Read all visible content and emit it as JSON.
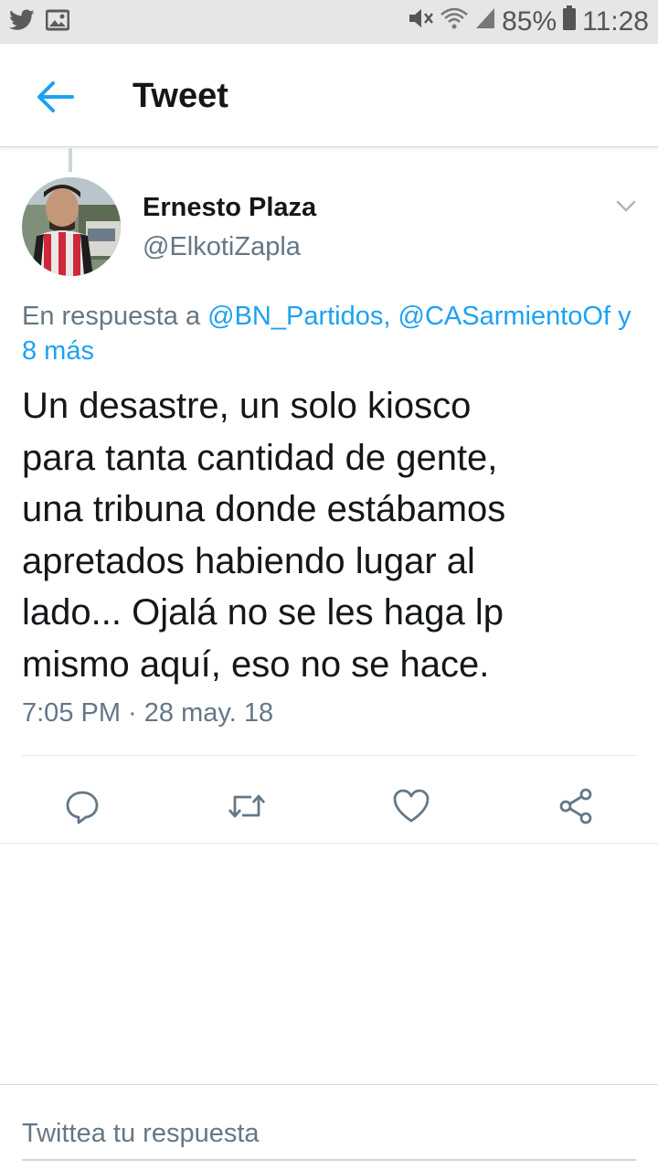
{
  "status_bar": {
    "battery": "85%",
    "time": "11:28",
    "icons": [
      "twitter-icon",
      "image-icon",
      "mute-icon",
      "wifi-icon",
      "signal-icon",
      "battery-icon"
    ]
  },
  "appbar": {
    "title": "Tweet"
  },
  "tweet": {
    "author_name": "Ernesto Plaza",
    "author_handle": "@ElkotiZapla",
    "reply_prefix": "En respuesta a ",
    "reply_mention_1": "@BN_Partidos,",
    "reply_mention_2": "@CASarmientoOf",
    "reply_suffix": " y",
    "reply_more": "8 más",
    "text_lines": [
      "Un desastre, un solo kiosco",
      "para tanta cantidad de gente,",
      "una tribuna donde estábamos",
      "apretados habiendo lugar al",
      "lado... Ojalá no se les haga lp",
      "mismo aquí, eso no se hace."
    ],
    "timestamp": "7:05 PM · 28 may. 18"
  },
  "actions": [
    "reply-icon",
    "retweet-icon",
    "like-icon",
    "share-icon"
  ],
  "reply_box": {
    "placeholder": "Twittea tu respuesta"
  },
  "colors": {
    "accent": "#1da1f2",
    "secondary_text": "#657786",
    "primary_text": "#14171a",
    "status_bar_bg": "#e6e6e6"
  }
}
